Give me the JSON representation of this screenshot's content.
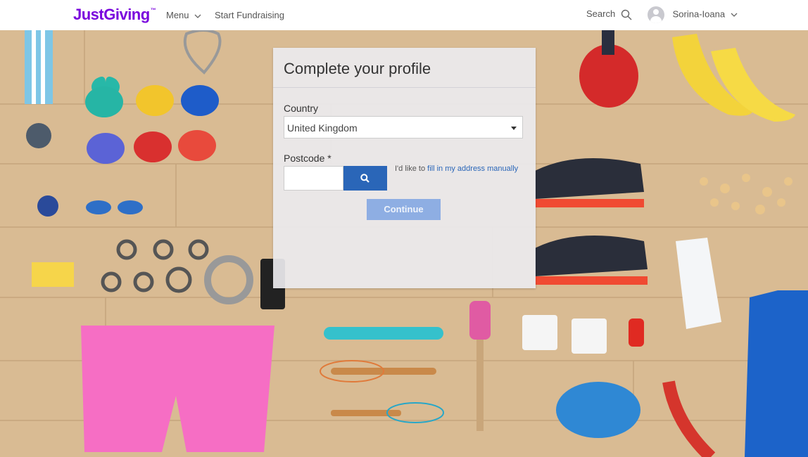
{
  "header": {
    "logo": "JustGiving",
    "logo_tm": "™",
    "menu_label": "Menu",
    "start_fundraising_label": "Start Fundraising",
    "search_label": "Search",
    "user_name": "Sorina-Ioana",
    "brand_color": "#7a04dd"
  },
  "profile": {
    "title": "Complete your profile",
    "country_label": "Country",
    "country_value": "United Kingdom",
    "postcode_label": "Postcode *",
    "postcode_value": "",
    "manual_prefix": "I'd like to",
    "manual_link": "fill in my address manually",
    "continue_label": "Continue",
    "accent_color": "#2a66b8"
  }
}
